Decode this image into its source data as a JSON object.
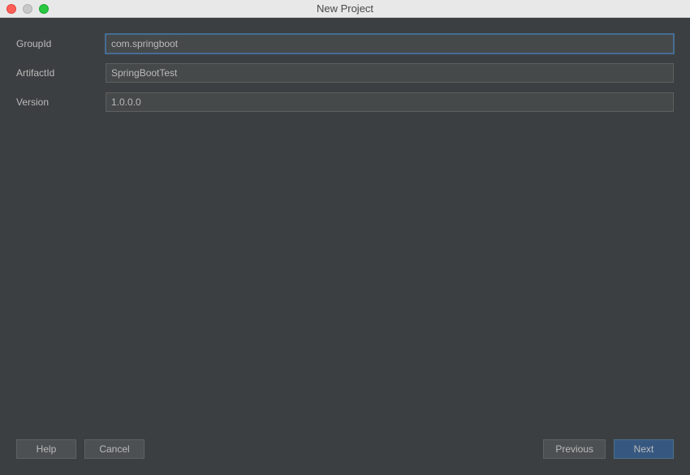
{
  "window": {
    "title": "New Project"
  },
  "form": {
    "groupId": {
      "label": "GroupId",
      "value": "com.springboot"
    },
    "artifactId": {
      "label": "ArtifactId",
      "value": "SpringBootTest"
    },
    "version": {
      "label": "Version",
      "value": "1.0.0.0"
    }
  },
  "buttons": {
    "help": "Help",
    "cancel": "Cancel",
    "previous": "Previous",
    "next": "Next"
  }
}
